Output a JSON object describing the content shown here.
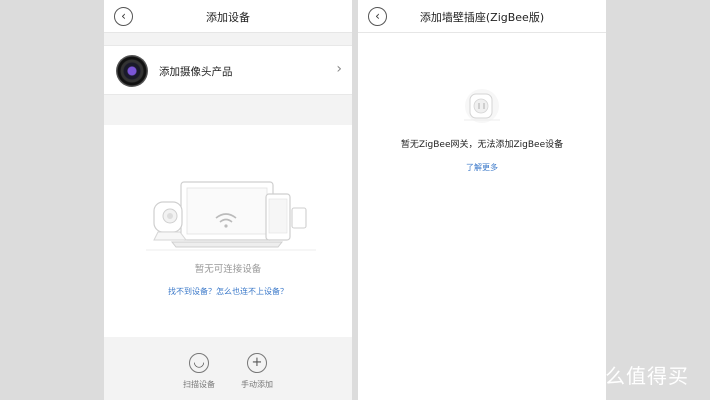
{
  "left_screen": {
    "title": "添加设备",
    "back_icon": "chevron-left-icon",
    "device_row": {
      "label": "添加摄像头产品",
      "icon": "camera-lens-icon",
      "chevron": "chevron-right-icon"
    },
    "empty_text": "暂无可连接设备",
    "help_link": "找不到设备？怎么也连不上设备？",
    "actions": [
      {
        "label": "扫描设备",
        "icon": "scan-icon"
      },
      {
        "label": "手动添加",
        "icon": "plus-icon"
      }
    ]
  },
  "right_screen": {
    "title": "添加墙壁插座(ZigBee版)",
    "back_icon": "chevron-left-icon",
    "empty_text": "暂无ZigBee网关，无法添加ZigBee设备",
    "more_link": "了解更多"
  },
  "watermark": {
    "text": "什么值得买"
  },
  "colors": {
    "link": "#3a78c9",
    "background": "#f3f3f3",
    "outer": "#dcdcdc"
  }
}
